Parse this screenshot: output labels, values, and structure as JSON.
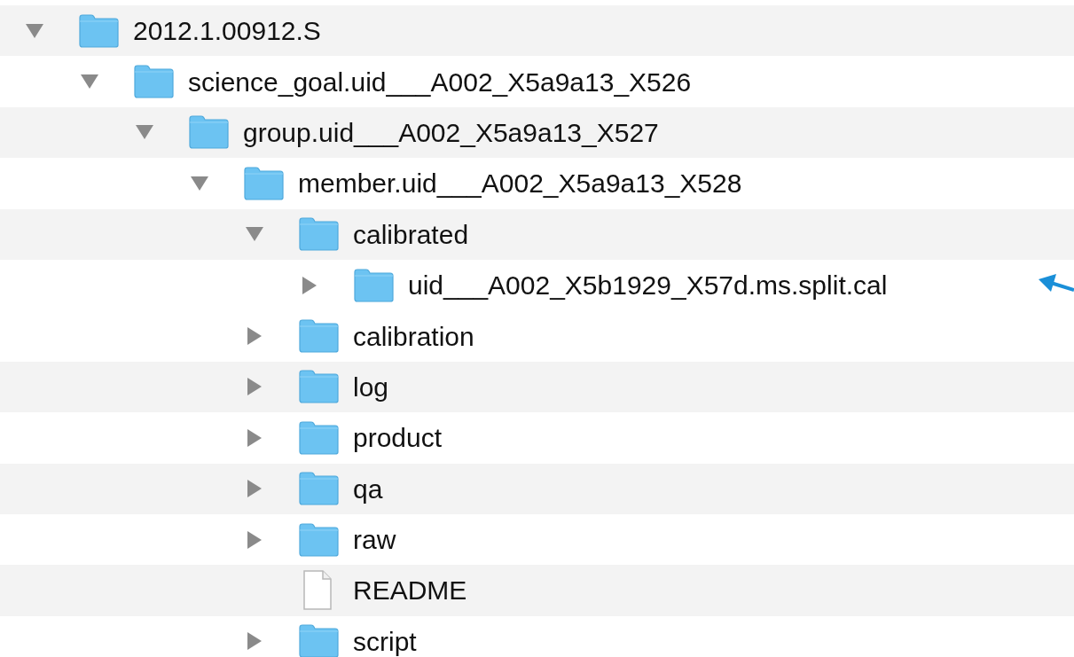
{
  "tree": [
    {
      "name": "2012.1.00912.S",
      "kind": "folder",
      "expanded": true,
      "shaded": true,
      "children": [
        {
          "name": "science_goal.uid___A002_X5a9a13_X526",
          "kind": "folder",
          "expanded": true,
          "shaded": false,
          "children": [
            {
              "name": "group.uid___A002_X5a9a13_X527",
              "kind": "folder",
              "expanded": true,
              "shaded": true,
              "children": [
                {
                  "name": "member.uid___A002_X5a9a13_X528",
                  "kind": "folder",
                  "expanded": true,
                  "shaded": false,
                  "children": [
                    {
                      "name": "calibrated",
                      "kind": "folder",
                      "expanded": true,
                      "shaded": true,
                      "children": [
                        {
                          "name": "uid___A002_X5b1929_X57d.ms.split.cal",
                          "kind": "folder",
                          "expanded": false,
                          "shaded": false,
                          "pointed_at": true
                        }
                      ]
                    },
                    {
                      "name": "calibration",
                      "kind": "folder",
                      "expanded": false,
                      "shaded": false
                    },
                    {
                      "name": "log",
                      "kind": "folder",
                      "expanded": false,
                      "shaded": true
                    },
                    {
                      "name": "product",
                      "kind": "folder",
                      "expanded": false,
                      "shaded": false
                    },
                    {
                      "name": "qa",
                      "kind": "folder",
                      "expanded": false,
                      "shaded": true
                    },
                    {
                      "name": "raw",
                      "kind": "folder",
                      "expanded": false,
                      "shaded": false
                    },
                    {
                      "name": "README",
                      "kind": "file",
                      "shaded": true
                    },
                    {
                      "name": "script",
                      "kind": "folder",
                      "expanded": false,
                      "shaded": false
                    }
                  ]
                }
              ]
            }
          ]
        }
      ]
    }
  ]
}
